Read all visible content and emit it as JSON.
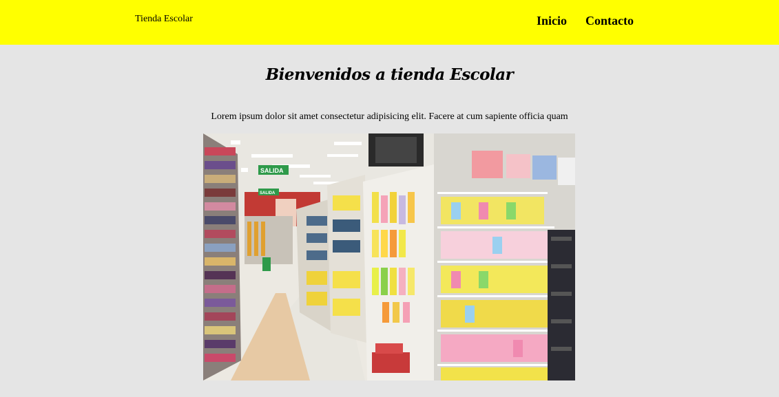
{
  "header": {
    "brand": "Tienda Escolar",
    "nav": [
      {
        "label": "Inicio"
      },
      {
        "label": "Contacto"
      }
    ],
    "background_color": "#ffff00"
  },
  "main": {
    "title": "Bienvenidos a tienda Escolar",
    "lead": "Lorem ipsum dolor sit amet consectetur adipisicing elit. Facere at cum sapiente officia quam",
    "image": {
      "subject": "school supplies store aisle with stationery shelves",
      "signs": [
        "SALIDA",
        "SALIDA"
      ]
    },
    "background_color": "#e5e5e5"
  }
}
